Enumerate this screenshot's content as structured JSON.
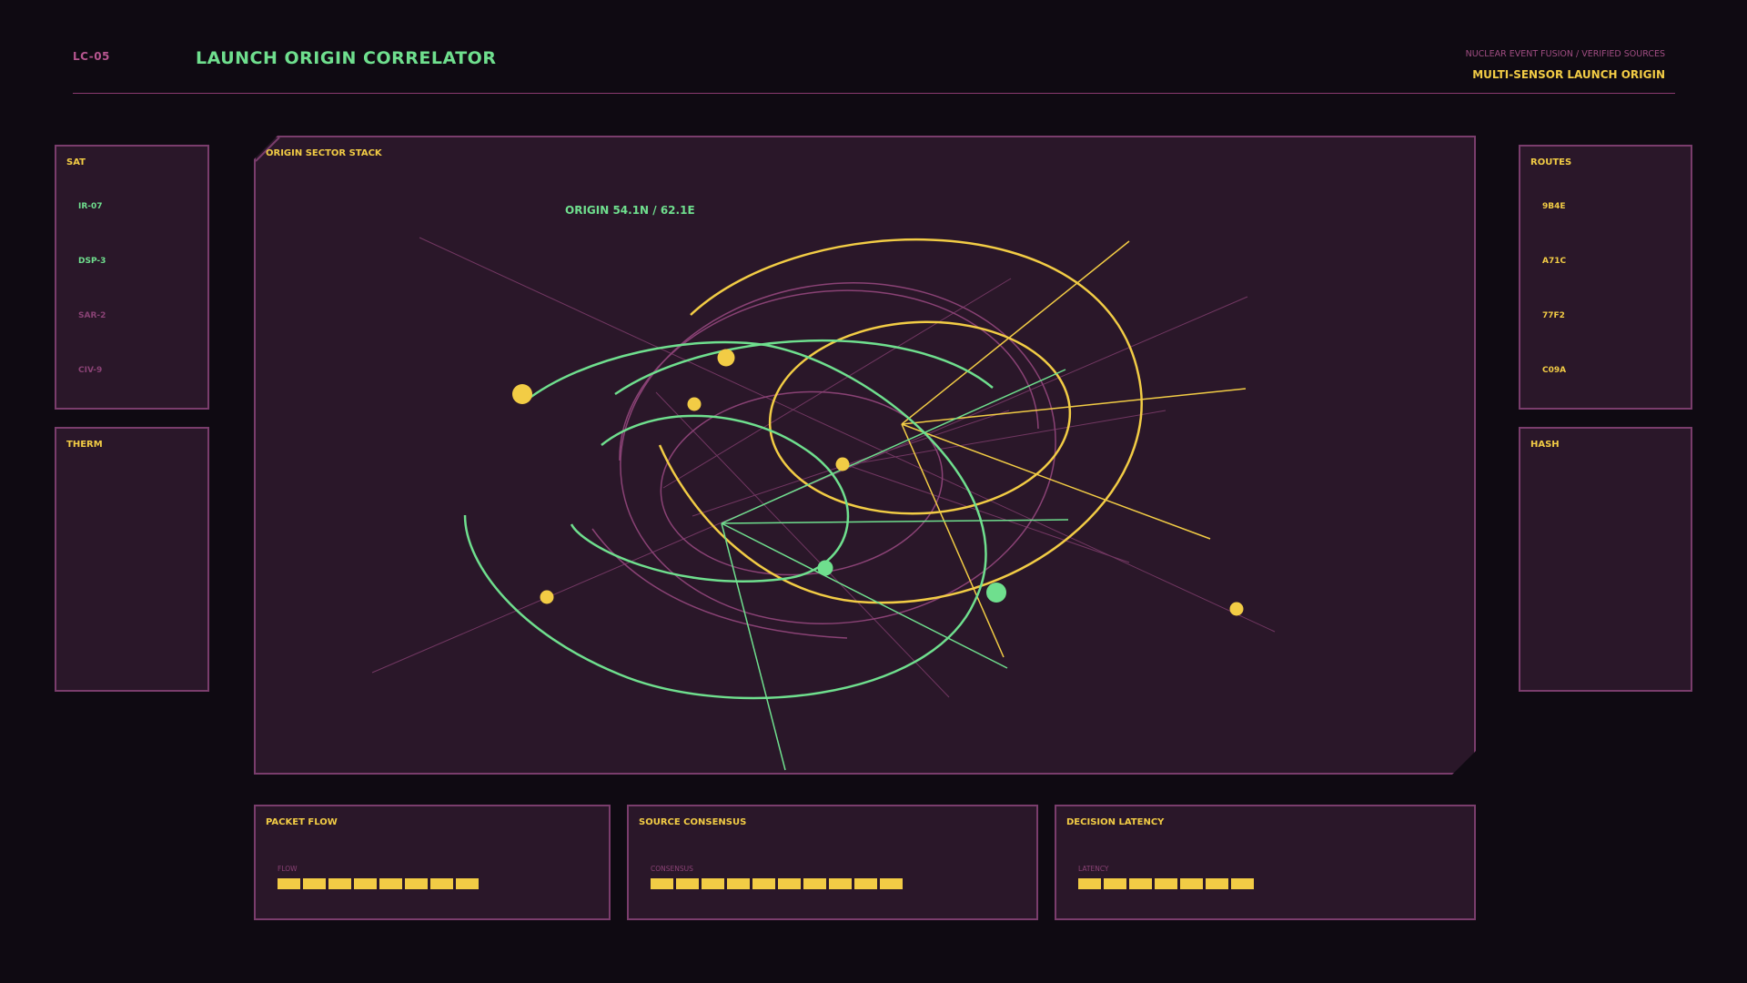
{
  "header": {
    "code": "LC-05",
    "title": "LAUNCH ORIGIN CORRELATOR",
    "subtitle": "NUCLEAR EVENT FUSION / VERIFIED SOURCES",
    "mode": "MULTI-SENSOR LAUNCH ORIGIN"
  },
  "left_panels": {
    "sat": {
      "title": "SAT",
      "items": [
        {
          "label": "IR-07",
          "state": "active"
        },
        {
          "label": "DSP-3",
          "state": "active"
        },
        {
          "label": "SAR-2",
          "state": "inactive"
        },
        {
          "label": "CIV-9",
          "state": "inactive"
        }
      ]
    },
    "therm": {
      "title": "THERM"
    }
  },
  "right_panels": {
    "routes": {
      "title": "ROUTES",
      "items": [
        {
          "label": "9B4E"
        },
        {
          "label": "A71C"
        },
        {
          "label": "77F2"
        },
        {
          "label": "C09A"
        }
      ]
    },
    "hash": {
      "title": "HASH"
    }
  },
  "main": {
    "title": "ORIGIN SECTOR STACK",
    "origin_readout": "ORIGIN 54.1N / 62.1E"
  },
  "metrics": [
    {
      "title": "PACKET FLOW",
      "label": "FLOW",
      "segments": 8
    },
    {
      "title": "SOURCE CONSENSUS",
      "label": "CONSENSUS",
      "segments": 10
    },
    {
      "title": "DECISION LATENCY",
      "label": "LATENCY",
      "segments": 7
    }
  ],
  "colors": {
    "background": "#0f0a12",
    "panel": "#2a1729",
    "panel_border": "#7a3d6c",
    "green": "#6fdf8e",
    "yellow": "#f2cc45",
    "magenta": "#a04d82"
  }
}
